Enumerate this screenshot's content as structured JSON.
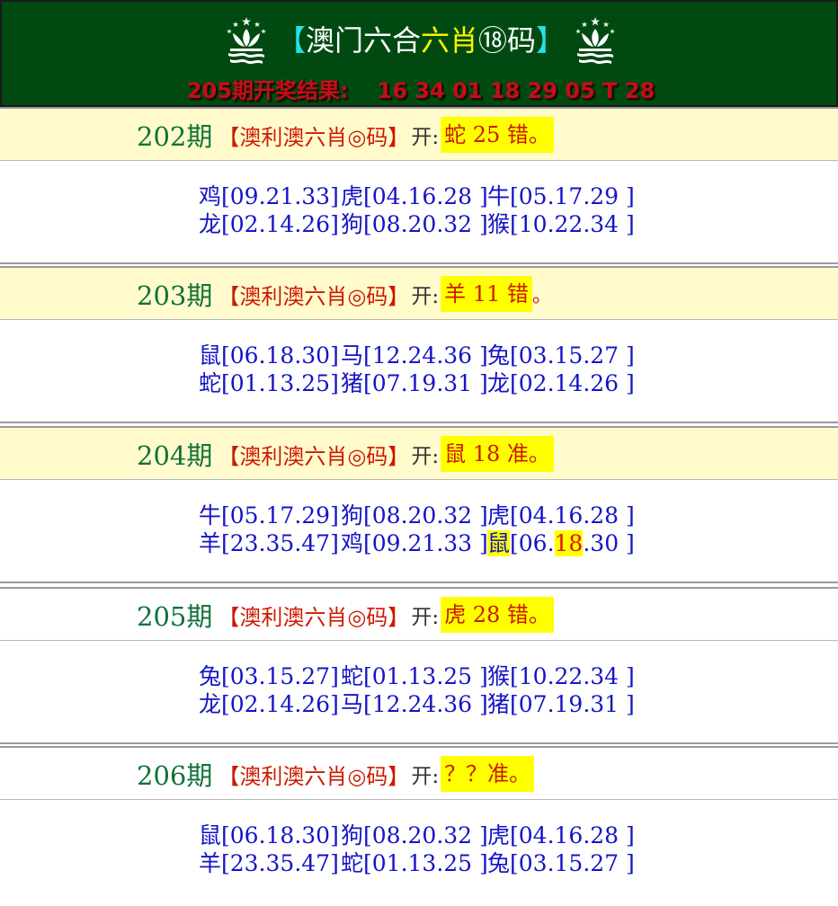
{
  "header": {
    "title_open": "【",
    "title_a": "澳门六合",
    "title_b": "六肖",
    "title_c": "⑱码",
    "title_close": "】",
    "result_label": "205期开奖结果:",
    "result_numbers": "16 34 01 18 29 05 T 28"
  },
  "issues": [
    {
      "no": "202期",
      "name": "【澳利澳六肖◎码】",
      "kai": "开:",
      "result": "蛇 25 错",
      "tail": "。",
      "picks": [
        [
          "鸡[09.21.33]",
          "虎[04.16.28 ]",
          "牛[05.17.29 ]"
        ],
        [
          "龙[02.14.26]",
          "狗[08.20.32 ]",
          "猴[10.22.34 ]"
        ]
      ]
    },
    {
      "no": "203期",
      "name": "【澳利澳六肖◎码】",
      "kai": "开:",
      "result": "羊 11 错",
      "tail": "。",
      "picks": [
        [
          "鼠[06.18.30]",
          "马[12.24.36 ]",
          "兔[03.15.27 ]"
        ],
        [
          "蛇[01.13.25]",
          "猪[07.19.31 ]",
          "龙[02.14.26 ]"
        ]
      ]
    },
    {
      "no": "204期",
      "name": "【澳利澳六肖◎码】",
      "kai": "开:",
      "result": "鼠 18 准",
      "tail": "。",
      "picks": [
        [
          "牛[05.17.29]",
          "狗[08.20.32 ]",
          "虎[04.16.28 ]"
        ],
        [
          "羊[23.35.47]",
          "鸡[09.21.33 ]",
          ""
        ]
      ],
      "hit": {
        "zodiac": "鼠",
        "pre": "[06.",
        "num": "18",
        "post": ".30 ]"
      }
    },
    {
      "no": "205期",
      "name": "【澳利澳六肖◎码】",
      "kai": "开:",
      "result": "虎 28 错",
      "tail": "。",
      "picks": [
        [
          "兔[03.15.27]",
          "蛇[01.13.25 ]",
          "猴[10.22.34 ]"
        ],
        [
          "龙[02.14.26]",
          "马[12.24.36 ]",
          "猪[07.19.31 ]"
        ]
      ]
    },
    {
      "no": "206期",
      "name": "【澳利澳六肖◎码】",
      "kai": "开:",
      "result": "？？准",
      "tail": "。",
      "picks": [
        [
          "鼠[06.18.30]",
          "狗[08.20.32 ]",
          "虎[04.16.28 ]"
        ],
        [
          "羊[23.35.47]",
          "蛇[01.13.25 ]",
          "兔[03.15.27 ]"
        ]
      ]
    }
  ]
}
